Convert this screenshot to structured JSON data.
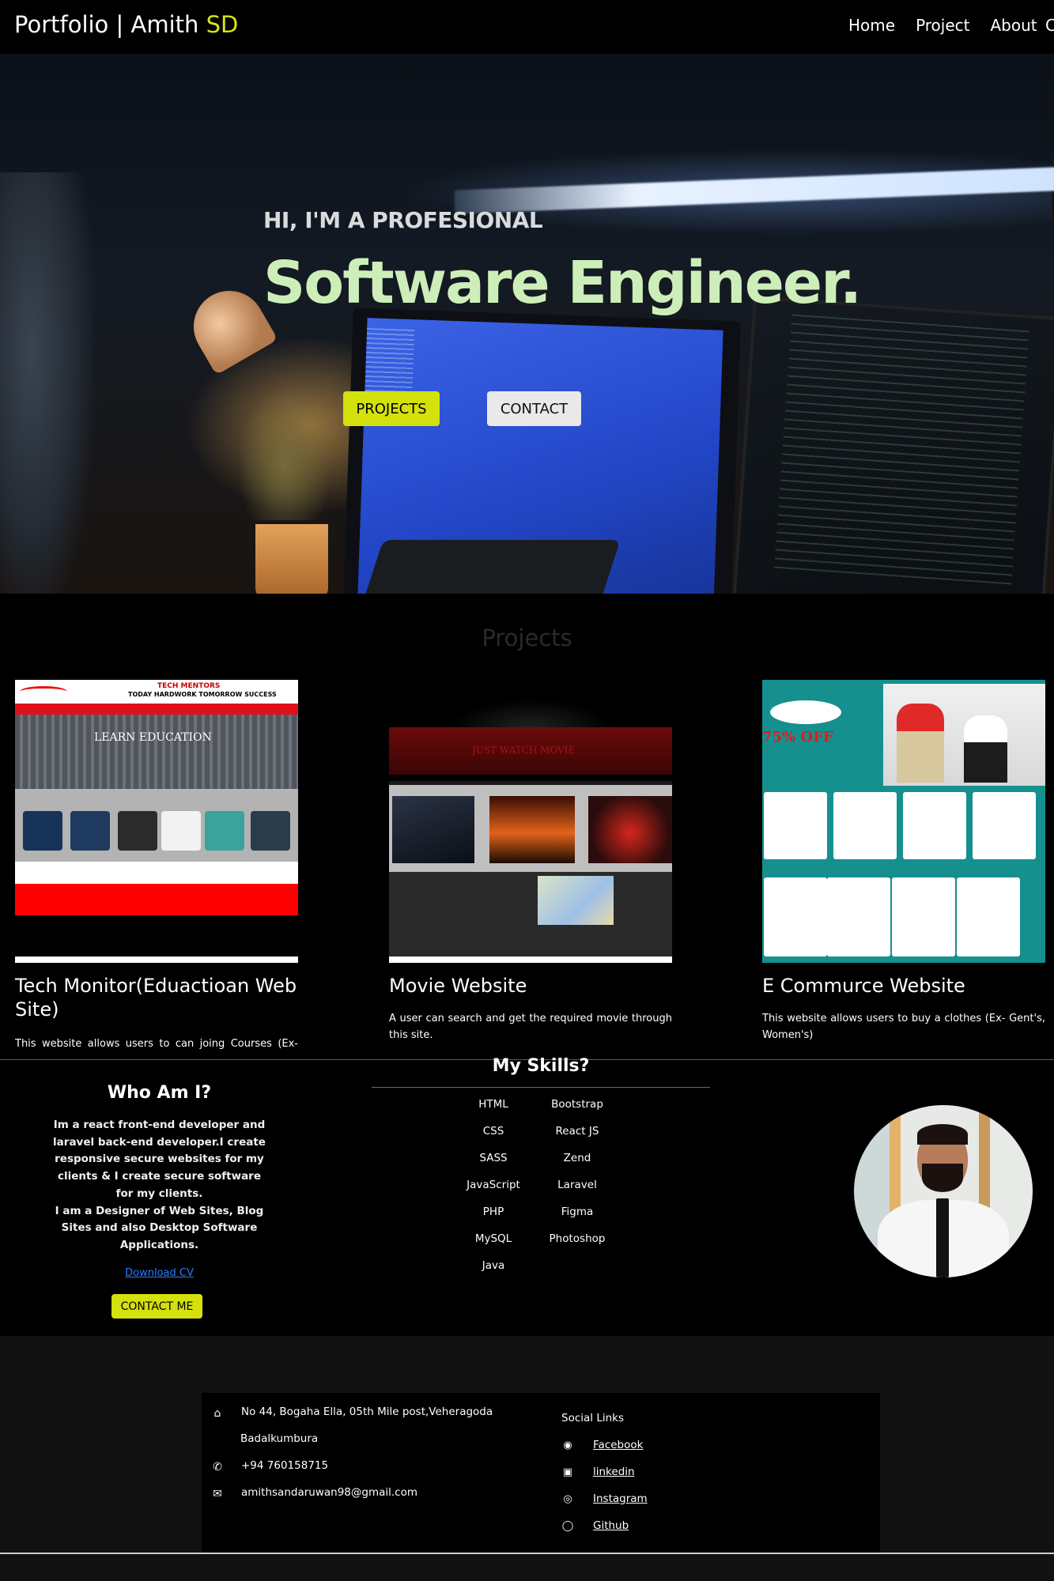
{
  "nav": {
    "brand_main": "Portfolio | Amith ",
    "brand_highlight": "SD",
    "links": [
      "Home",
      "Project",
      "About",
      "C"
    ]
  },
  "hero": {
    "kicker": "HI, I'M A PROFESIONAL",
    "title": "Software Engineer.",
    "projects_button": "PROJECTS",
    "contact_button": "CONTACT"
  },
  "projects": {
    "title": "Projects",
    "cards": [
      {
        "title": "Tech Monitor(Eduactioan Web Site)",
        "description": "This website allows users to can joing Courses (Ex- Python, Web Development, Java)",
        "thumb_texts": [
          "TECH MENTORS",
          "TODAY HARDWORK TOMORROW SUCCESS",
          "LEARN EDUCATION"
        ]
      },
      {
        "title": "Movie Website",
        "description": "A user can search and get the required movie through this site.",
        "thumb_texts": [
          "JUST WATCH MOVIE"
        ]
      },
      {
        "title": "E Commurce Website",
        "description": "This website allows users to buy a clothes (Ex- Gent's, Women's)",
        "thumb_texts": [
          "75% OFF"
        ]
      }
    ]
  },
  "about": {
    "title": "Who Am I?",
    "text": "Im a react front-end developer and laravel back-end developer.I create responsive secure websites for my clients & I create secure software for my clients.",
    "text2": "I am a Designer of Web Sites, Blog Sites and also Desktop Software Applications.",
    "download_link": "Download CV",
    "contact_button": "CONTACT ME"
  },
  "skills": {
    "title": "My Skills?",
    "left": [
      "HTML",
      "CSS",
      "SASS",
      "JavaScript",
      "PHP",
      "MySQL",
      "Java"
    ],
    "right": [
      "Bootstrap",
      "React JS",
      "Zend",
      "Laravel",
      "Figma",
      "Photoshop"
    ]
  },
  "footer": {
    "address_line1": "No 44, Bogaha Ella, 05th Mile post,Veheragoda",
    "address_line2": "Badalkumbura",
    "phone": "+94 760158715",
    "email": "amithsandaruwan98@gmail.com",
    "social_title": "Social Links",
    "social": [
      "Facebook",
      "linkedin",
      "Instagram",
      "Github"
    ]
  },
  "colors": {
    "accent": "#d4e10c",
    "hero_title": "#cdeeb8",
    "link": "#2c7bff"
  }
}
